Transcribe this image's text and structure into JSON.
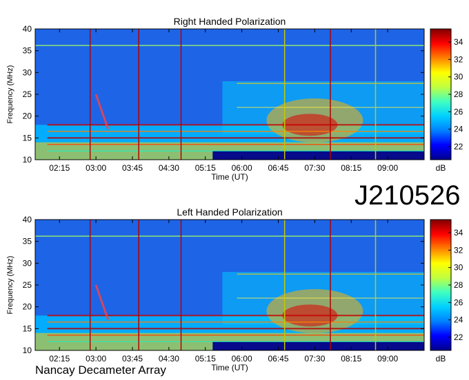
{
  "observation_id": "J210526",
  "instrument": "Nancay Decameter Array",
  "colorbar_unit": "dB",
  "colormap": [
    "#00008b",
    "#0000ff",
    "#0080ff",
    "#00d0ff",
    "#40ffc0",
    "#c0ff40",
    "#ffff00",
    "#ff8000",
    "#ff0000",
    "#800000"
  ],
  "chart_data": [
    {
      "type": "heatmap",
      "title": "Right Handed Polarization",
      "xlabel": "Time (UT)",
      "ylabel": "Frequency (MHz)",
      "x_ticks": [
        "02:15",
        "03:00",
        "03:45",
        "04:30",
        "05:15",
        "06:00",
        "06:45",
        "07:30",
        "08:15",
        "09:00"
      ],
      "x_tick_hours": [
        2.25,
        3.0,
        3.75,
        4.5,
        5.25,
        6.0,
        6.75,
        7.5,
        8.25,
        9.0
      ],
      "xlim_hours": [
        1.75,
        9.75
      ],
      "y_ticks": [
        10,
        15,
        20,
        25,
        30,
        35,
        40
      ],
      "ylim": [
        10,
        40
      ],
      "colorbar_ticks": [
        22,
        24,
        26,
        28,
        30,
        32,
        34
      ],
      "colorbar_range": [
        20.5,
        35.5
      ],
      "vertical_markers": [
        {
          "hour": 2.88,
          "color": "#b40000"
        },
        {
          "hour": 3.88,
          "color": "#b40000"
        },
        {
          "hour": 4.75,
          "color": "#b40000"
        },
        {
          "hour": 6.88,
          "color": "#c8c800"
        },
        {
          "hour": 7.82,
          "color": "#b40000"
        },
        {
          "hour": 8.75,
          "color": "#c8c800"
        }
      ]
    },
    {
      "type": "heatmap",
      "title": "Left Handed Polarization",
      "xlabel": "Time (UT)",
      "ylabel": "Frequency (MHz)",
      "x_ticks": [
        "02:15",
        "03:00",
        "03:45",
        "04:30",
        "05:15",
        "06:00",
        "06:45",
        "07:30",
        "08:15",
        "09:00"
      ],
      "x_tick_hours": [
        2.25,
        3.0,
        3.75,
        4.5,
        5.25,
        6.0,
        6.75,
        7.5,
        8.25,
        9.0
      ],
      "xlim_hours": [
        1.75,
        9.75
      ],
      "y_ticks": [
        10,
        15,
        20,
        25,
        30,
        35,
        40
      ],
      "ylim": [
        10,
        40
      ],
      "colorbar_ticks": [
        22,
        24,
        26,
        28,
        30,
        32,
        34
      ],
      "colorbar_range": [
        20.5,
        35.5
      ],
      "vertical_markers": [
        {
          "hour": 2.88,
          "color": "#b40000"
        },
        {
          "hour": 3.88,
          "color": "#b40000"
        },
        {
          "hour": 4.75,
          "color": "#b40000"
        },
        {
          "hour": 6.88,
          "color": "#c8c800"
        },
        {
          "hour": 7.82,
          "color": "#b40000"
        },
        {
          "hour": 8.75,
          "color": "#c8c800"
        }
      ]
    }
  ]
}
